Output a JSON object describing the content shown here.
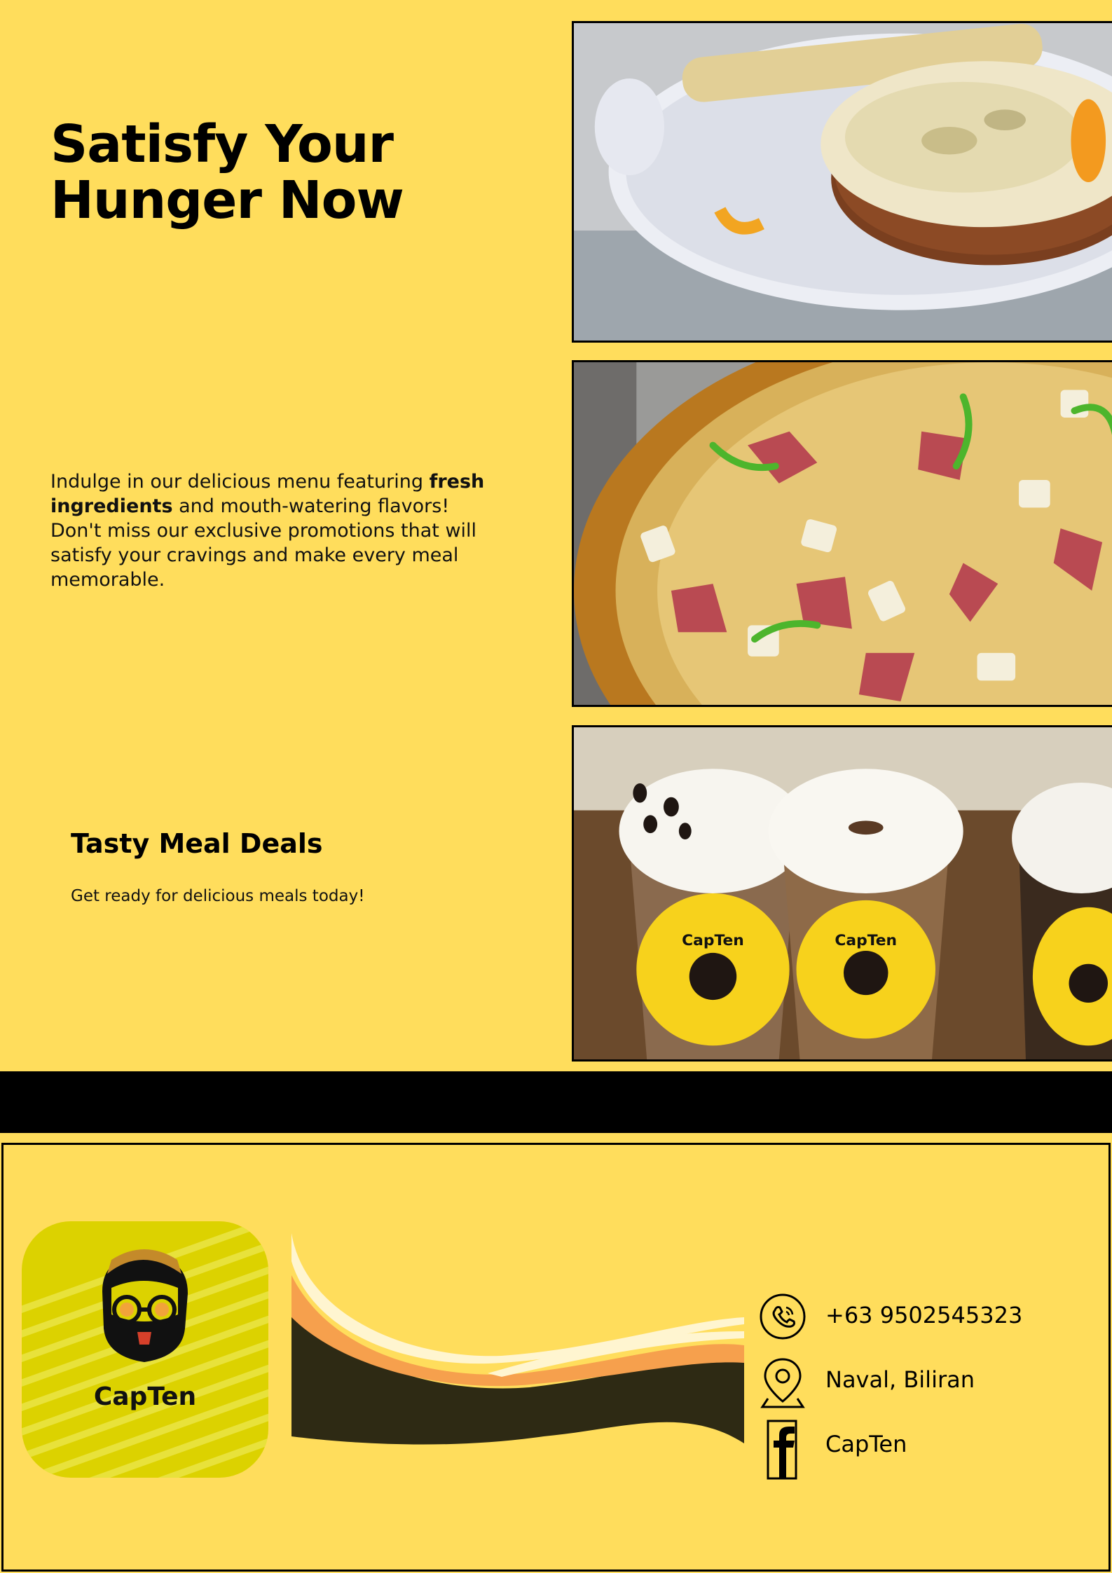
{
  "hero": {
    "title_line1": "Satisfy Your",
    "title_line2": "Hunger Now"
  },
  "intro": {
    "text_before": "Indulge in our delicious menu featuring ",
    "text_bold": "fresh ingredients",
    "text_after": " and mouth-watering flavors! Don't miss our exclusive promotions that will satisfy your cravings and make every meal memorable."
  },
  "deals": {
    "title": "Tasty Meal Deals",
    "subtitle": "Get ready for delicious meals today!"
  },
  "photos": [
    {
      "icon": "lasagna-photo"
    },
    {
      "icon": "pizza-photo"
    },
    {
      "icon": "milkshakes-photo",
      "cup_label": "CapTen"
    }
  ],
  "logo": {
    "brand": "CapTen"
  },
  "contact": {
    "phone": "+63 9502545323",
    "location": "Naval, Biliran",
    "facebook": "CapTen",
    "icons": [
      "phone-icon",
      "location-pin-icon",
      "facebook-icon"
    ]
  },
  "colors": {
    "background": "#ffdd5c",
    "band": "#000000",
    "logo_tile": "#dcd200",
    "wave_orange": "#f6a04d",
    "wave_dark": "#2e2a14",
    "wave_cream": "#fff5d0"
  }
}
